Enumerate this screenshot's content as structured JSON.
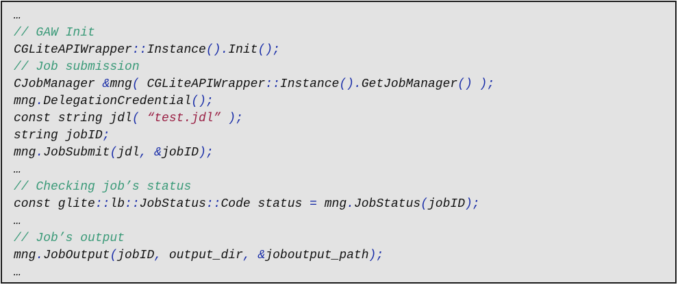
{
  "colors": {
    "background": "#e3e3e3",
    "border": "#1a1a1a",
    "text": "#111111",
    "comment": "#3a9a78",
    "punctuation": "#1a2ea8",
    "string": "#9a2145"
  },
  "lines": [
    [
      {
        "t": "…",
        "k": "n"
      }
    ],
    [
      {
        "t": "// GAW Init",
        "k": "c"
      }
    ],
    [
      {
        "t": "CGLiteAPIWrapper",
        "k": "n"
      },
      {
        "t": "::",
        "k": "p"
      },
      {
        "t": "Instance",
        "k": "n"
      },
      {
        "t": "().",
        "k": "p"
      },
      {
        "t": "Init",
        "k": "n"
      },
      {
        "t": "();",
        "k": "p"
      }
    ],
    [
      {
        "t": "// Job submission",
        "k": "c"
      }
    ],
    [
      {
        "t": "CJobManager ",
        "k": "n"
      },
      {
        "t": "&",
        "k": "p"
      },
      {
        "t": "mng",
        "k": "n"
      },
      {
        "t": "( ",
        "k": "p"
      },
      {
        "t": "CGLiteAPIWrapper",
        "k": "n"
      },
      {
        "t": "::",
        "k": "p"
      },
      {
        "t": "Instance",
        "k": "n"
      },
      {
        "t": "().",
        "k": "p"
      },
      {
        "t": "GetJobManager",
        "k": "n"
      },
      {
        "t": "() );",
        "k": "p"
      }
    ],
    [
      {
        "t": "mng",
        "k": "n"
      },
      {
        "t": ".",
        "k": "p"
      },
      {
        "t": "DelegationCredential",
        "k": "n"
      },
      {
        "t": "();",
        "k": "p"
      }
    ],
    [
      {
        "t": "const string jdl",
        "k": "n"
      },
      {
        "t": "( ",
        "k": "p"
      },
      {
        "t": "“test.jdl”",
        "k": "s"
      },
      {
        "t": " );",
        "k": "p"
      }
    ],
    [
      {
        "t": "string jobID",
        "k": "n"
      },
      {
        "t": ";",
        "k": "p"
      }
    ],
    [
      {
        "t": "mng",
        "k": "n"
      },
      {
        "t": ".",
        "k": "p"
      },
      {
        "t": "JobSubmit",
        "k": "n"
      },
      {
        "t": "(",
        "k": "p"
      },
      {
        "t": "jdl",
        "k": "n"
      },
      {
        "t": ", &",
        "k": "p"
      },
      {
        "t": "jobID",
        "k": "n"
      },
      {
        "t": ");",
        "k": "p"
      }
    ],
    [
      {
        "t": "…",
        "k": "n"
      }
    ],
    [
      {
        "t": "// Checking job’s status",
        "k": "c"
      }
    ],
    [
      {
        "t": "const glite",
        "k": "n"
      },
      {
        "t": "::",
        "k": "p"
      },
      {
        "t": "lb",
        "k": "n"
      },
      {
        "t": "::",
        "k": "p"
      },
      {
        "t": "JobStatus",
        "k": "n"
      },
      {
        "t": "::",
        "k": "p"
      },
      {
        "t": "Code status ",
        "k": "n"
      },
      {
        "t": "=",
        "k": "p"
      },
      {
        "t": " mng",
        "k": "n"
      },
      {
        "t": ".",
        "k": "p"
      },
      {
        "t": "JobStatus",
        "k": "n"
      },
      {
        "t": "(",
        "k": "p"
      },
      {
        "t": "jobID",
        "k": "n"
      },
      {
        "t": ");",
        "k": "p"
      }
    ],
    [
      {
        "t": "…",
        "k": "n"
      }
    ],
    [
      {
        "t": "// Job’s output",
        "k": "c"
      }
    ],
    [
      {
        "t": "mng",
        "k": "n"
      },
      {
        "t": ".",
        "k": "p"
      },
      {
        "t": "JobOutput",
        "k": "n"
      },
      {
        "t": "(",
        "k": "p"
      },
      {
        "t": "jobID",
        "k": "n"
      },
      {
        "t": ", ",
        "k": "p"
      },
      {
        "t": "output_dir",
        "k": "n"
      },
      {
        "t": ", &",
        "k": "p"
      },
      {
        "t": "joboutput_path",
        "k": "n"
      },
      {
        "t": ");",
        "k": "p"
      }
    ],
    [
      {
        "t": "…",
        "k": "n"
      }
    ]
  ]
}
